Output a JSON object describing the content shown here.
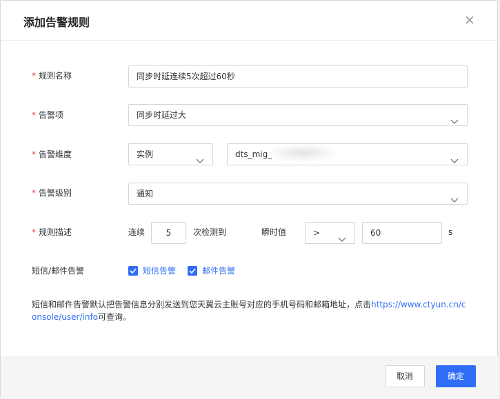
{
  "dialog": {
    "title": "添加告警规则",
    "close_icon": "close-icon"
  },
  "form": {
    "rule_name": {
      "label": "规则名称",
      "required_mark": "*",
      "value": "同步时延连续5次超过60秒"
    },
    "alarm_item": {
      "label": "告警项",
      "required_mark": "*",
      "value": "同步时延过大"
    },
    "alarm_dimension": {
      "label": "告警维度",
      "required_mark": "*",
      "dimension_value": "实例",
      "instance_value": "dts_mig_"
    },
    "alarm_level": {
      "label": "告警级别",
      "required_mark": "*",
      "value": "通知"
    },
    "rule_desc": {
      "label": "规则描述",
      "required_mark": "*",
      "prefix": "连续",
      "count_value": "5",
      "middle": "次检测到",
      "metric_label": "瞬时值",
      "operator_value": ">",
      "threshold_value": "60",
      "unit": "s"
    },
    "notify": {
      "label": "短信/邮件告警",
      "sms_label": "短信告警",
      "sms_checked": true,
      "email_label": "邮件告警",
      "email_checked": true
    },
    "note": {
      "text": "短信和邮件告警默认把告警信息分别发送到您天翼云主账号对应的手机号码和邮箱地址，点击",
      "link": "https://www.ctyun.cn/console/user/info",
      "suffix": "可查询。"
    }
  },
  "footer": {
    "cancel_label": "取消",
    "ok_label": "确定"
  },
  "colors": {
    "primary": "#2f6df6",
    "required": "#e83e3e",
    "footer_bg": "#f5f5f5"
  }
}
